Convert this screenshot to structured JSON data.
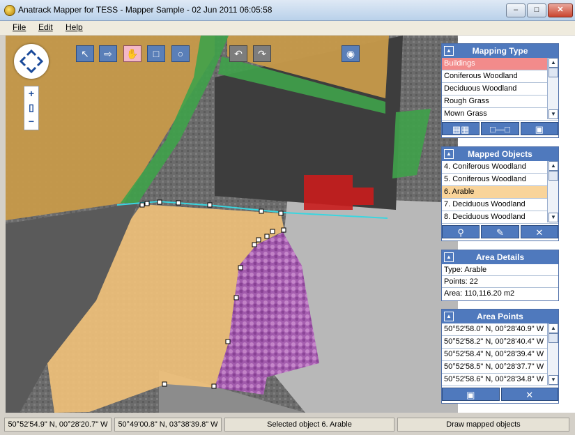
{
  "window": {
    "title": "Anatrack Mapper for TESS - Mapper Sample - 02 Jun 2011 06:05:58",
    "min_label": "–",
    "max_label": "□",
    "close_label": "✕"
  },
  "menu": [
    {
      "label": "File"
    },
    {
      "label": "Edit"
    },
    {
      "label": "Help"
    }
  ],
  "map_tools": {
    "select_icon": "↖",
    "move_icon": "⇨",
    "freehand_icon": "✋",
    "rect_icon": "□",
    "circle_icon": "○",
    "undo_icon": "↶",
    "redo_icon": "↷",
    "layer_icon": "◉",
    "zoom_in": "+",
    "zoom_mid": "▯",
    "zoom_out": "−"
  },
  "mapping_type": {
    "title": "Mapping Type",
    "items": [
      "Buildings",
      "Coniferous Woodland",
      "Deciduous Woodland",
      "Rough Grass",
      "Mown Grass"
    ],
    "selected_index": 0
  },
  "mapped_objects": {
    "title": "Mapped Objects",
    "items": [
      "4. Coniferous Woodland",
      "5. Coniferous Woodland",
      "6. Arable",
      "7. Deciduous Woodland",
      "8. Deciduous Woodland"
    ],
    "selected_index": 2
  },
  "area_details": {
    "title": "Area Details",
    "type": "Type: Arable",
    "points": "Points: 22",
    "area": "Area: 110,116.20 m2"
  },
  "area_points": {
    "title": "Area Points",
    "items": [
      "50°52'58.0\" N, 00°28'40.9\" W",
      "50°52'58.2\" N, 00°28'40.4\" W",
      "50°52'58.4\" N, 00°28'39.4\" W",
      "50°52'58.5\" N, 00°28'37.7\" W",
      "50°52'58.6\" N, 00°28'34.8\" W"
    ]
  },
  "status": {
    "coord1": "50°52'54.9\" N, 00°28'20.7\" W",
    "coord2": "50°49'00.8\" N, 03°38'39.8\" W",
    "selected": "Selected object 6. Arable",
    "mode": "Draw mapped objects"
  },
  "colors": {
    "panel_header": "#4f79bd",
    "arable": "#f2c27a",
    "woodland": "#3fa24a",
    "deciduous": "#b35ab8",
    "buildings": "#c91c1c"
  }
}
